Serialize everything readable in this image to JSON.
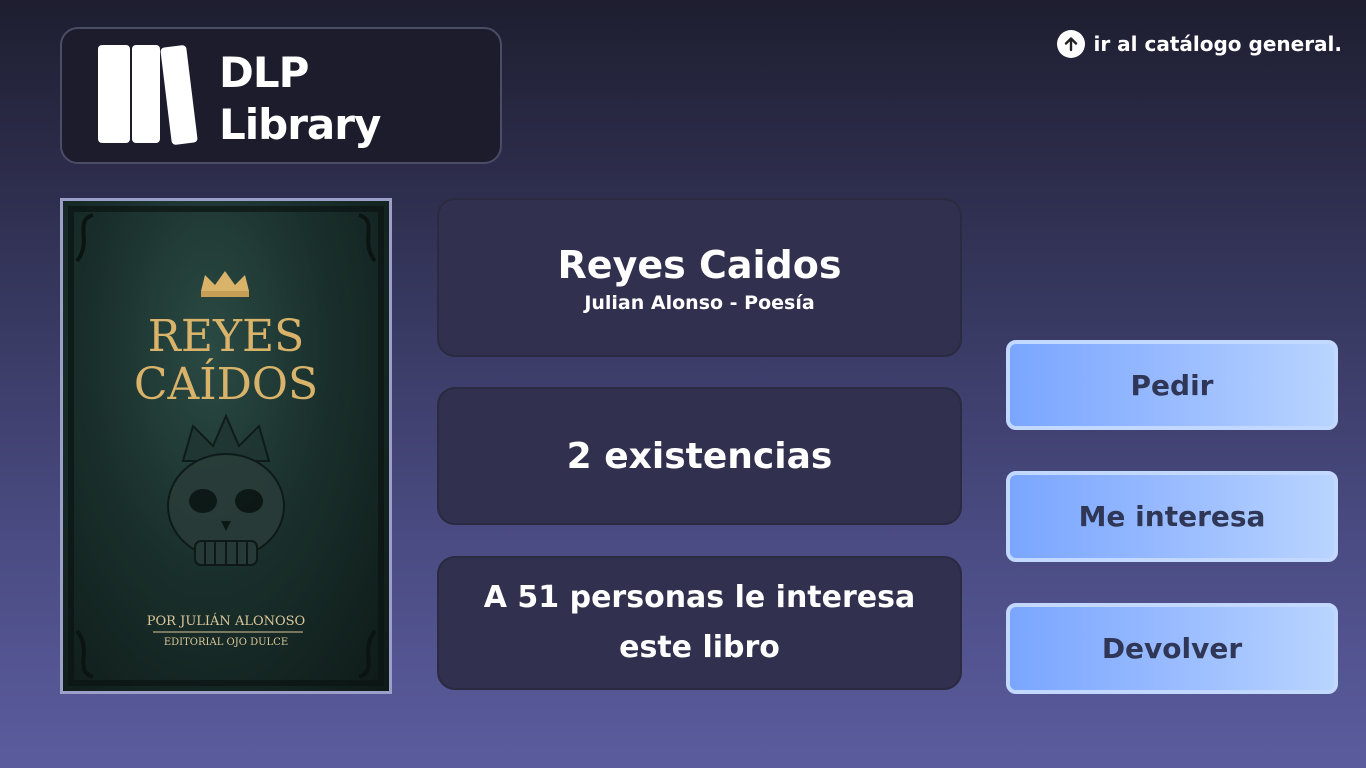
{
  "header": {
    "logo_line1": "DLP",
    "logo_line2": "Library",
    "catalog_link": "ir al catálogo general."
  },
  "book": {
    "title": "Reyes Caidos",
    "subtitle": "Julian Alonso - Poesía",
    "stock": "2 existencias",
    "interest": "A 51 personas le interesa este libro",
    "cover": {
      "title_line1": "REYES",
      "title_line2": "CAÍDOS",
      "author": "POR JULIÁN ALONOSO",
      "publisher": "EDITORIAL OJO DULCE"
    }
  },
  "actions": {
    "pedir": "Pedir",
    "me_interesa": "Me interesa",
    "devolver": "Devolver"
  },
  "colors": {
    "accent_button": "#99bbff",
    "panel": "#31304f",
    "cover_title_gold": "#d9b36a"
  },
  "icons": {
    "logo": "books-icon",
    "catalog": "arrow-up-circle-icon"
  }
}
